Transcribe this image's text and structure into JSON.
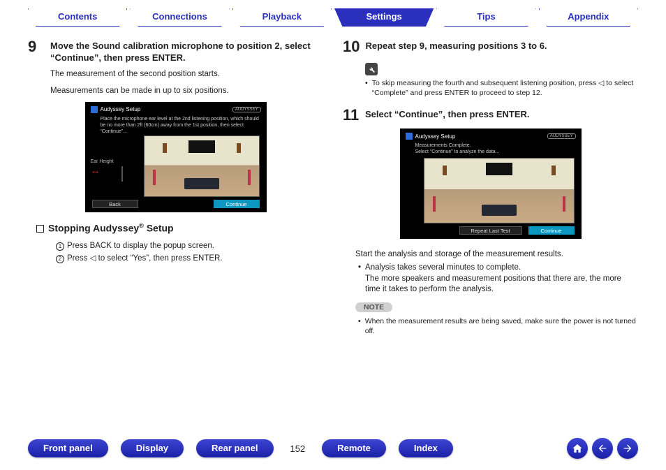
{
  "topnav": {
    "items": [
      "Contents",
      "Connections",
      "Playback",
      "Settings",
      "Tips",
      "Appendix"
    ],
    "activeIndex": 3
  },
  "left": {
    "step9": {
      "num": "9",
      "title": "Move the Sound calibration microphone to position 2, select “Continue”, then press ENTER.",
      "body1": "The measurement of the second position starts.",
      "body2": "Measurements can be made in up to six positions."
    },
    "screenshot1": {
      "header": "Audyssey Setup",
      "badge": "AUDYSSEY",
      "text": "Place the microphone ear level at the 2nd listening position, which should be no more than 2ft (60cm) away from the 1st position, then select “Continue”...",
      "earHeight": "Ear Height",
      "back": "Back",
      "cont": "Continue"
    },
    "stopping": {
      "heading_pre": "Stopping Audyssey",
      "heading_suf": " Setup",
      "item1": "Press BACK to display the popup screen.",
      "item2": "Press ◁ to select “Yes”, then press ENTER."
    }
  },
  "right": {
    "step10": {
      "num": "10",
      "title": "Repeat step 9, measuring positions 3 to 6.",
      "tip": "To skip measuring the fourth and subsequent listening position, press ◁ to select “Complete” and press ENTER to proceed to step 12."
    },
    "step11": {
      "num": "11",
      "title": "Select “Continue”, then press ENTER."
    },
    "screenshot2": {
      "header": "Audyssey Setup",
      "badge": "AUDYSSEY",
      "text": "Measurements Complete.\nSelect “Continue” to analyze the data...",
      "repeat": "Repeat Last Test",
      "cont": "Continue"
    },
    "analysis": {
      "line1": "Start the analysis and storage of the measurement results.",
      "bullet_a": "Analysis takes several minutes to complete.",
      "bullet_b": "The more speakers and measurement positions that there are, the more time it takes to perform the analysis."
    },
    "note": {
      "label": "NOTE",
      "bullet": "When the measurement results are being saved, make sure the power is not turned off."
    }
  },
  "bottom": {
    "items": [
      "Front panel",
      "Display",
      "Rear panel"
    ],
    "page": "152",
    "items2": [
      "Remote",
      "Index"
    ]
  }
}
